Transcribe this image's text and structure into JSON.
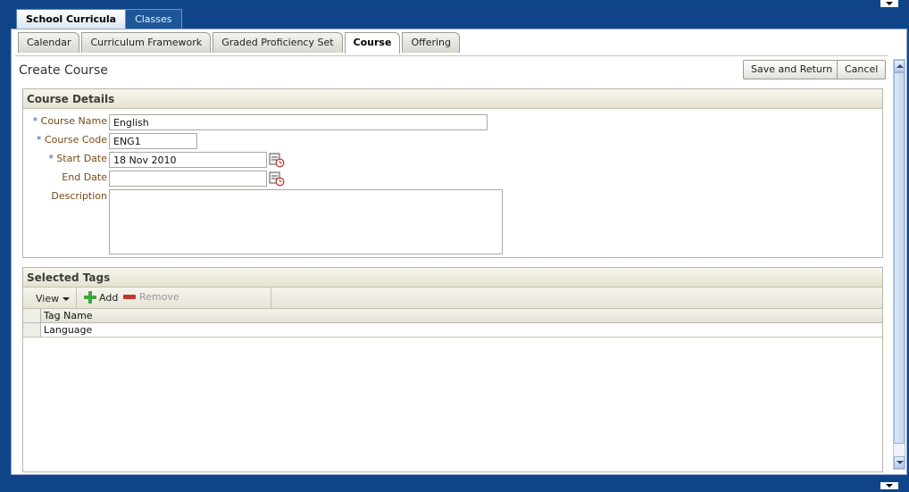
{
  "primary_tabs": [
    {
      "label": "School Curricula",
      "active": true
    },
    {
      "label": "Classes",
      "active": false
    }
  ],
  "secondary_tabs": [
    {
      "label": "Calendar",
      "active": false
    },
    {
      "label": "Curriculum Framework",
      "active": false
    },
    {
      "label": "Graded Proficiency Set",
      "active": false
    },
    {
      "label": "Course",
      "active": true
    },
    {
      "label": "Offering",
      "active": false
    }
  ],
  "page": {
    "title": "Create Course",
    "save_label": "Save and Return",
    "cancel_label": "Cancel"
  },
  "course_details": {
    "header": "Course Details",
    "required_marker": "*",
    "fields": {
      "course_name": {
        "label": "Course Name",
        "value": "English"
      },
      "course_code": {
        "label": "Course Code",
        "value": "ENG1"
      },
      "start_date": {
        "label": "Start Date",
        "value": "18 Nov 2010"
      },
      "end_date": {
        "label": "End Date",
        "value": ""
      },
      "description": {
        "label": "Description",
        "value": ""
      }
    }
  },
  "selected_tags": {
    "header": "Selected Tags",
    "toolbar": {
      "view_label": "View",
      "add_label": "Add",
      "remove_label": "Remove"
    },
    "columns": [
      "Tag Name"
    ],
    "rows": [
      [
        "Language"
      ]
    ]
  },
  "icons": {
    "calendar": "calendar-icon",
    "add": "plus-icon",
    "remove": "minus-icon"
  }
}
